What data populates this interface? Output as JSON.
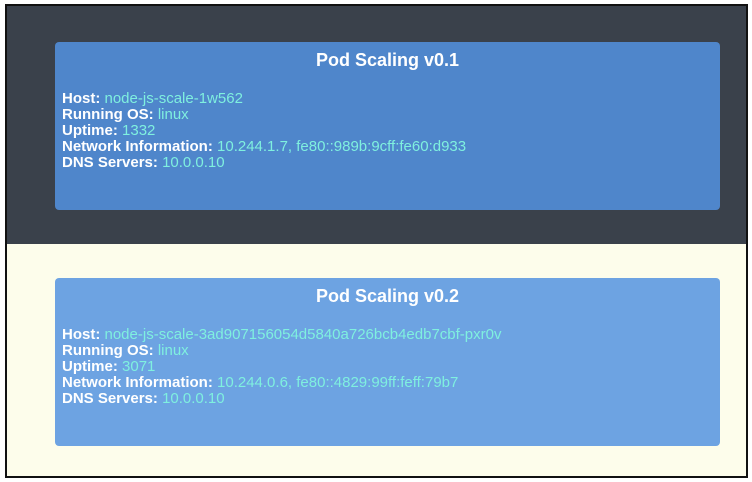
{
  "cards": [
    {
      "title": "Pod Scaling v0.1",
      "rows": [
        {
          "label": "Host:",
          "value": "node-js-scale-1w562"
        },
        {
          "label": "Running OS:",
          "value": "linux"
        },
        {
          "label": "Uptime:",
          "value": "1332"
        },
        {
          "label": "Network Information:",
          "value": "10.244.1.7, fe80::989b:9cff:fe60:d933"
        },
        {
          "label": "DNS Servers:",
          "value": "10.0.0.10"
        }
      ]
    },
    {
      "title": "Pod Scaling v0.2",
      "rows": [
        {
          "label": "Host:",
          "value": "node-js-scale-3ad907156054d5840a726bcb4edb7cbf-pxr0v"
        },
        {
          "label": "Running OS:",
          "value": "linux"
        },
        {
          "label": "Uptime:",
          "value": "3071"
        },
        {
          "label": "Network Information:",
          "value": "10.244.0.6, fe80::4829:99ff:feff:79b7"
        },
        {
          "label": "DNS Servers:",
          "value": "10.0.0.10"
        }
      ]
    }
  ],
  "colors": {
    "top_background": "#3a414b",
    "bottom_background": "#fdfdeb",
    "card1_background": "#4f86cb",
    "card2_background": "#6da3e2",
    "label_text": "#ffffff",
    "value_text": "#7ff0df"
  }
}
